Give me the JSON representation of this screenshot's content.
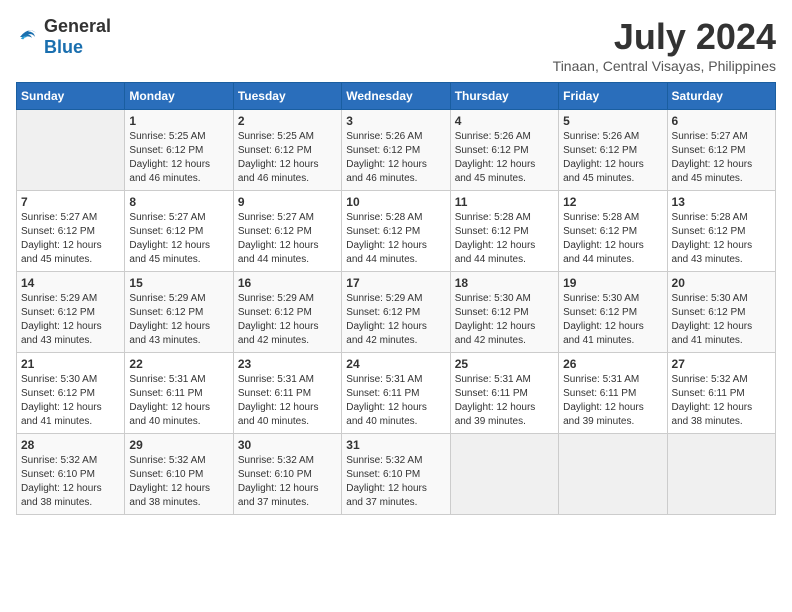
{
  "logo": {
    "text_general": "General",
    "text_blue": "Blue"
  },
  "title": "July 2024",
  "subtitle": "Tinaan, Central Visayas, Philippines",
  "days_header": [
    "Sunday",
    "Monday",
    "Tuesday",
    "Wednesday",
    "Thursday",
    "Friday",
    "Saturday"
  ],
  "weeks": [
    [
      {
        "day": "",
        "sunrise": "",
        "sunset": "",
        "daylight": ""
      },
      {
        "day": "1",
        "sunrise": "Sunrise: 5:25 AM",
        "sunset": "Sunset: 6:12 PM",
        "daylight": "Daylight: 12 hours and 46 minutes."
      },
      {
        "day": "2",
        "sunrise": "Sunrise: 5:25 AM",
        "sunset": "Sunset: 6:12 PM",
        "daylight": "Daylight: 12 hours and 46 minutes."
      },
      {
        "day": "3",
        "sunrise": "Sunrise: 5:26 AM",
        "sunset": "Sunset: 6:12 PM",
        "daylight": "Daylight: 12 hours and 46 minutes."
      },
      {
        "day": "4",
        "sunrise": "Sunrise: 5:26 AM",
        "sunset": "Sunset: 6:12 PM",
        "daylight": "Daylight: 12 hours and 45 minutes."
      },
      {
        "day": "5",
        "sunrise": "Sunrise: 5:26 AM",
        "sunset": "Sunset: 6:12 PM",
        "daylight": "Daylight: 12 hours and 45 minutes."
      },
      {
        "day": "6",
        "sunrise": "Sunrise: 5:27 AM",
        "sunset": "Sunset: 6:12 PM",
        "daylight": "Daylight: 12 hours and 45 minutes."
      }
    ],
    [
      {
        "day": "7",
        "sunrise": "Sunrise: 5:27 AM",
        "sunset": "Sunset: 6:12 PM",
        "daylight": "Daylight: 12 hours and 45 minutes."
      },
      {
        "day": "8",
        "sunrise": "Sunrise: 5:27 AM",
        "sunset": "Sunset: 6:12 PM",
        "daylight": "Daylight: 12 hours and 45 minutes."
      },
      {
        "day": "9",
        "sunrise": "Sunrise: 5:27 AM",
        "sunset": "Sunset: 6:12 PM",
        "daylight": "Daylight: 12 hours and 44 minutes."
      },
      {
        "day": "10",
        "sunrise": "Sunrise: 5:28 AM",
        "sunset": "Sunset: 6:12 PM",
        "daylight": "Daylight: 12 hours and 44 minutes."
      },
      {
        "day": "11",
        "sunrise": "Sunrise: 5:28 AM",
        "sunset": "Sunset: 6:12 PM",
        "daylight": "Daylight: 12 hours and 44 minutes."
      },
      {
        "day": "12",
        "sunrise": "Sunrise: 5:28 AM",
        "sunset": "Sunset: 6:12 PM",
        "daylight": "Daylight: 12 hours and 44 minutes."
      },
      {
        "day": "13",
        "sunrise": "Sunrise: 5:28 AM",
        "sunset": "Sunset: 6:12 PM",
        "daylight": "Daylight: 12 hours and 43 minutes."
      }
    ],
    [
      {
        "day": "14",
        "sunrise": "Sunrise: 5:29 AM",
        "sunset": "Sunset: 6:12 PM",
        "daylight": "Daylight: 12 hours and 43 minutes."
      },
      {
        "day": "15",
        "sunrise": "Sunrise: 5:29 AM",
        "sunset": "Sunset: 6:12 PM",
        "daylight": "Daylight: 12 hours and 43 minutes."
      },
      {
        "day": "16",
        "sunrise": "Sunrise: 5:29 AM",
        "sunset": "Sunset: 6:12 PM",
        "daylight": "Daylight: 12 hours and 42 minutes."
      },
      {
        "day": "17",
        "sunrise": "Sunrise: 5:29 AM",
        "sunset": "Sunset: 6:12 PM",
        "daylight": "Daylight: 12 hours and 42 minutes."
      },
      {
        "day": "18",
        "sunrise": "Sunrise: 5:30 AM",
        "sunset": "Sunset: 6:12 PM",
        "daylight": "Daylight: 12 hours and 42 minutes."
      },
      {
        "day": "19",
        "sunrise": "Sunrise: 5:30 AM",
        "sunset": "Sunset: 6:12 PM",
        "daylight": "Daylight: 12 hours and 41 minutes."
      },
      {
        "day": "20",
        "sunrise": "Sunrise: 5:30 AM",
        "sunset": "Sunset: 6:12 PM",
        "daylight": "Daylight: 12 hours and 41 minutes."
      }
    ],
    [
      {
        "day": "21",
        "sunrise": "Sunrise: 5:30 AM",
        "sunset": "Sunset: 6:12 PM",
        "daylight": "Daylight: 12 hours and 41 minutes."
      },
      {
        "day": "22",
        "sunrise": "Sunrise: 5:31 AM",
        "sunset": "Sunset: 6:11 PM",
        "daylight": "Daylight: 12 hours and 40 minutes."
      },
      {
        "day": "23",
        "sunrise": "Sunrise: 5:31 AM",
        "sunset": "Sunset: 6:11 PM",
        "daylight": "Daylight: 12 hours and 40 minutes."
      },
      {
        "day": "24",
        "sunrise": "Sunrise: 5:31 AM",
        "sunset": "Sunset: 6:11 PM",
        "daylight": "Daylight: 12 hours and 40 minutes."
      },
      {
        "day": "25",
        "sunrise": "Sunrise: 5:31 AM",
        "sunset": "Sunset: 6:11 PM",
        "daylight": "Daylight: 12 hours and 39 minutes."
      },
      {
        "day": "26",
        "sunrise": "Sunrise: 5:31 AM",
        "sunset": "Sunset: 6:11 PM",
        "daylight": "Daylight: 12 hours and 39 minutes."
      },
      {
        "day": "27",
        "sunrise": "Sunrise: 5:32 AM",
        "sunset": "Sunset: 6:11 PM",
        "daylight": "Daylight: 12 hours and 38 minutes."
      }
    ],
    [
      {
        "day": "28",
        "sunrise": "Sunrise: 5:32 AM",
        "sunset": "Sunset: 6:10 PM",
        "daylight": "Daylight: 12 hours and 38 minutes."
      },
      {
        "day": "29",
        "sunrise": "Sunrise: 5:32 AM",
        "sunset": "Sunset: 6:10 PM",
        "daylight": "Daylight: 12 hours and 38 minutes."
      },
      {
        "day": "30",
        "sunrise": "Sunrise: 5:32 AM",
        "sunset": "Sunset: 6:10 PM",
        "daylight": "Daylight: 12 hours and 37 minutes."
      },
      {
        "day": "31",
        "sunrise": "Sunrise: 5:32 AM",
        "sunset": "Sunset: 6:10 PM",
        "daylight": "Daylight: 12 hours and 37 minutes."
      },
      {
        "day": "",
        "sunrise": "",
        "sunset": "",
        "daylight": ""
      },
      {
        "day": "",
        "sunrise": "",
        "sunset": "",
        "daylight": ""
      },
      {
        "day": "",
        "sunrise": "",
        "sunset": "",
        "daylight": ""
      }
    ]
  ]
}
